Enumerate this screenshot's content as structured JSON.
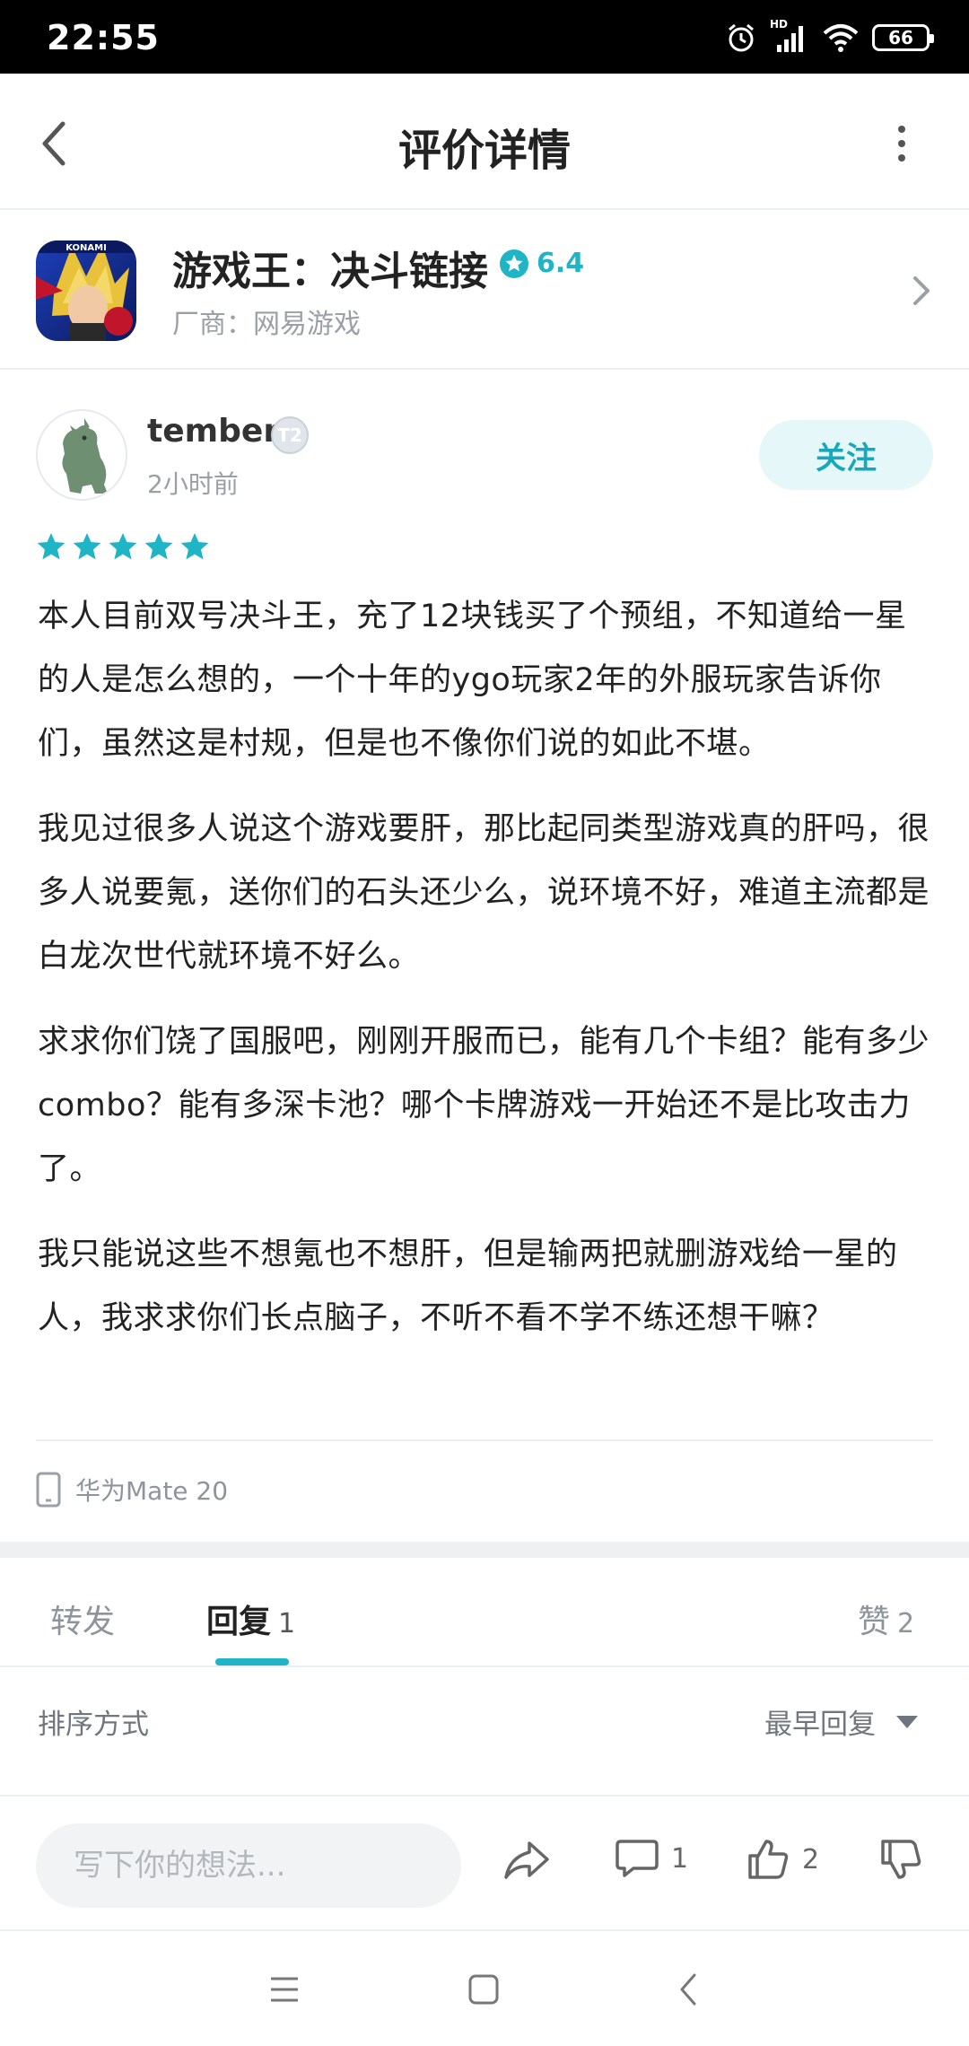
{
  "status_bar": {
    "time": "22:55",
    "network": "HD",
    "battery": "66"
  },
  "header": {
    "title": "评价详情"
  },
  "app": {
    "name": "游戏王：决斗链接",
    "rating": "6.4",
    "vendor": "厂商：网易游戏",
    "icon_text": "KONAMI"
  },
  "review": {
    "author": "tember",
    "level": "T2",
    "time": "2小时前",
    "follow_label": "关注",
    "stars": 5,
    "paragraphs": [
      "本人目前双号决斗王，充了12块钱买了个预组，不知道给一星的人是怎么想的，一个十年的ygo玩家2年的外服玩家告诉你们，虽然这是村规，但是也不像你们说的如此不堪。",
      "我见过很多人说这个游戏要肝，那比起同类型游戏真的肝吗，很多人说要氪，送你们的石头还少么，说环境不好，难道主流都是白龙次世代就环境不好么。",
      "求求你们饶了国服吧，刚刚开服而已，能有几个卡组？能有多少combo？能有多深卡池？哪个卡牌游戏一开始还不是比攻击力了。",
      "我只能说这些不想氪也不想肝，但是输两把就删游戏给一星的人，我求求你们长点脑子，不听不看不学不练还想干嘛？"
    ],
    "device": "华为Mate 20"
  },
  "tabs": {
    "repost": "转发",
    "reply": "回复",
    "reply_count": "1",
    "like": "赞",
    "like_count": "2"
  },
  "sort": {
    "label": "排序方式",
    "selected": "最早回复"
  },
  "bottom_bar": {
    "placeholder": "写下你的想法...",
    "comment_count": "1",
    "like_count": "2"
  },
  "colors": {
    "accent": "#1fb5c6",
    "accent_light": "#e6f7f9"
  }
}
